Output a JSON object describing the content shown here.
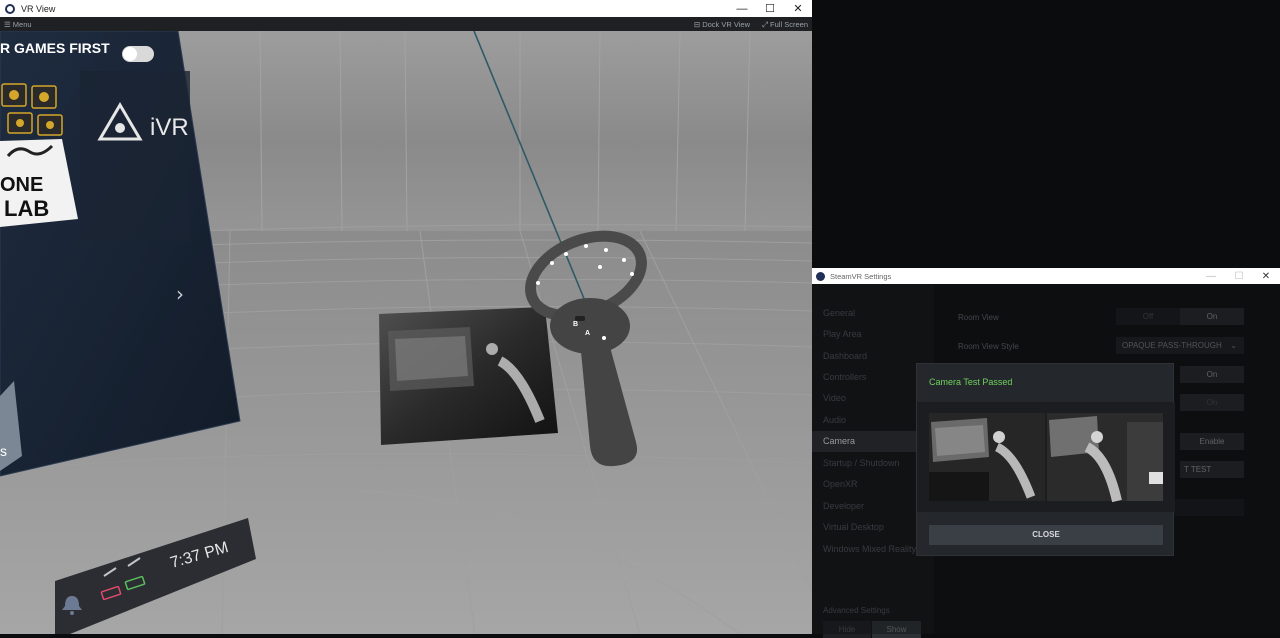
{
  "vr_window": {
    "title": "VR View",
    "menu_label": "☰ Menu",
    "dock_label": "⊟ Dock VR View",
    "fullscreen_label": "⤢ Full Screen",
    "controls": {
      "minimize": "—",
      "maximize": "☐",
      "close": "✕"
    }
  },
  "vr_scene": {
    "dashboard_toggle_label": "R GAMES FIRST",
    "brand_text": "iVR",
    "tile_text_line1": "ONE",
    "tile_text_line2": "LAB",
    "side_fragment": "s",
    "arrow_glyph": "›",
    "clock": "7:37 PM",
    "controller_buttons": [
      "B",
      "A"
    ]
  },
  "settings_window": {
    "title": "SteamVR Settings",
    "controls": {
      "minimize": "—",
      "maximize": "☐",
      "close": "✕"
    },
    "nav": [
      "General",
      "Play Area",
      "Dashboard",
      "Controllers",
      "Video",
      "Audio",
      "Camera",
      "Startup / Shutdown",
      "OpenXR",
      "Developer",
      "Virtual Desktop",
      "Windows Mixed Reality"
    ],
    "active_nav": "Camera",
    "advanced_settings": {
      "label": "Advanced Settings",
      "hide": "Hide",
      "show": "Show"
    },
    "rows": {
      "room_view_label": "Room View",
      "room_view_off": "Off",
      "room_view_on": "On",
      "room_view_style_label": "Room View Style",
      "room_view_style_value": "OPAQUE PASS-THROUGH",
      "row3_on": "On",
      "row4_on": "On",
      "enable": "Enable",
      "test_fragment": "T TEST"
    }
  },
  "modal": {
    "title": "Camera Test Passed",
    "close_label": "CLOSE",
    "accent_color": "#6fd35e"
  }
}
